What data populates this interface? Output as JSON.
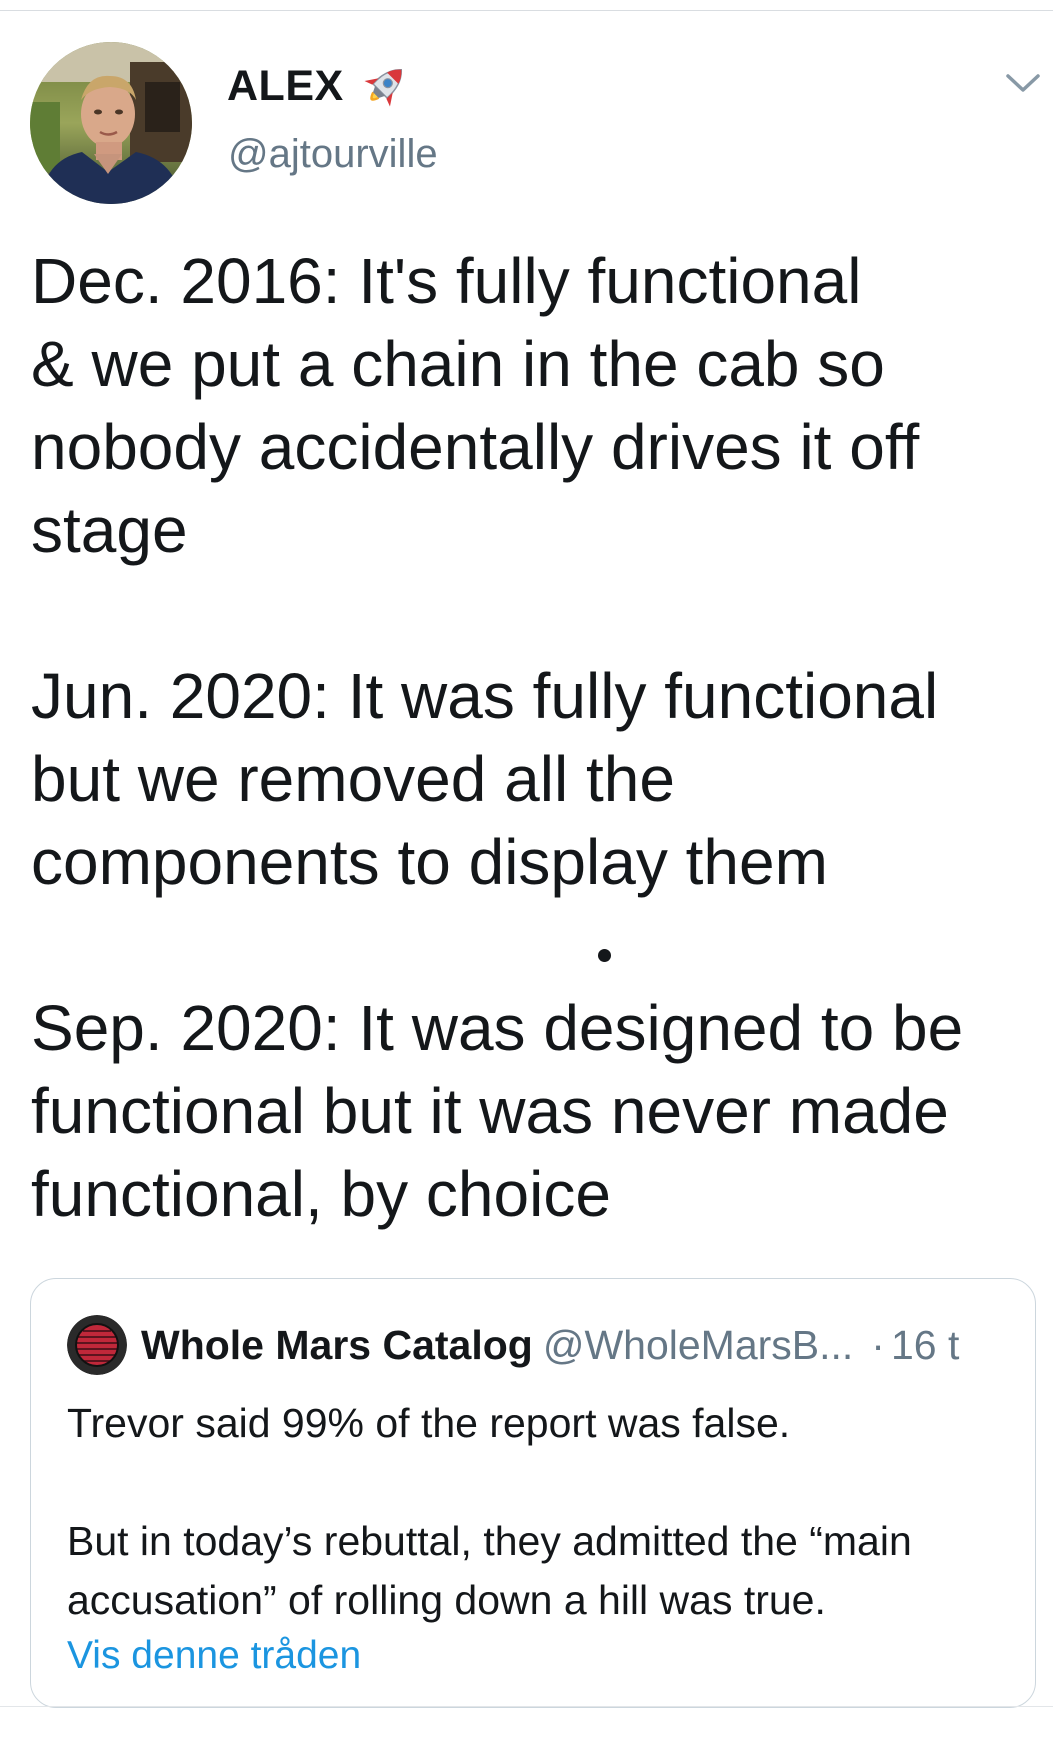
{
  "author": {
    "display_name": "ALEX",
    "handle": "@ajtourville",
    "avatar_icon": "profile-photo",
    "badge_icon": "rocket-emoji"
  },
  "tweet": {
    "paragraph_1": "Dec. 2016: It's fully functional\n& we put a chain in the cab so\nnobody accidentally drives it off\nstage",
    "paragraph_2": "Jun. 2020: It was fully functional\nbut we removed all the\ncomponents to display them",
    "paragraph_3": "Sep. 2020: It was designed to be\nfunctional but it was never made\nfunctional, by choice"
  },
  "quoted_tweet": {
    "display_name": "Whole Mars Catalog",
    "handle": "@WholeMarsB...",
    "separator": "·",
    "time": "16 t",
    "paragraph_1": "Trevor said 99% of the report was false.",
    "paragraph_2": "But in today’s rebuttal, they admitted the “main accusation” of rolling down a hill was true.",
    "show_thread_label": "Vis denne tråden"
  },
  "colors": {
    "text": "#14171a",
    "secondary": "#657786",
    "link": "#1b95e0",
    "border": "#ccd6dd"
  },
  "icons": {
    "menu": "chevron-down-icon"
  }
}
